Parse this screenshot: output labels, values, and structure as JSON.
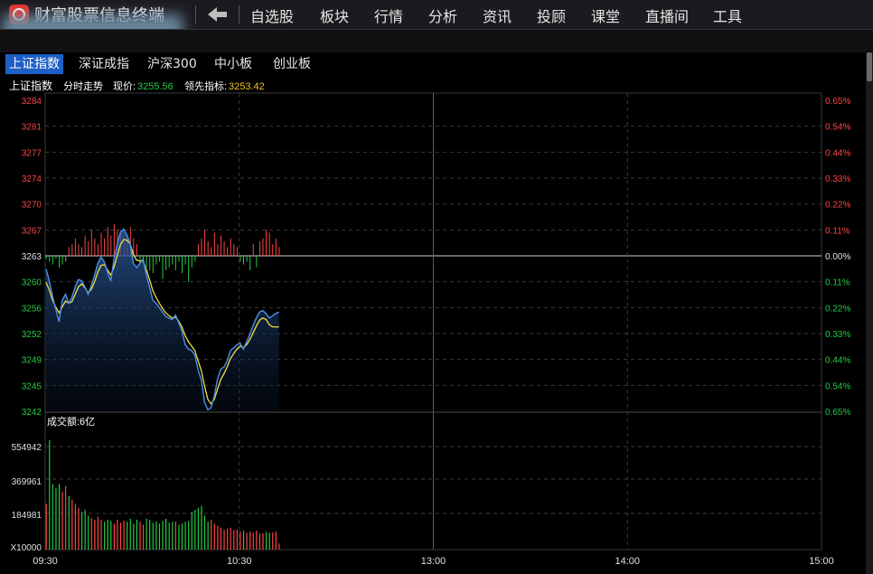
{
  "app": {
    "title": "财富股票信息终端"
  },
  "nav": {
    "items": [
      "自选股",
      "板块",
      "行情",
      "分析",
      "资讯",
      "投顾",
      "课堂",
      "直播间",
      "工具"
    ]
  },
  "tabs": [
    {
      "label": "上证指数",
      "active": true
    },
    {
      "label": "深证成指",
      "active": false
    },
    {
      "label": "沪深300",
      "active": false
    },
    {
      "label": "中小板",
      "active": false
    },
    {
      "label": "创业板",
      "active": false
    }
  ],
  "info": {
    "name": "上证指数",
    "mode": "分时走势",
    "price_label": "现价:",
    "price": "3255.56",
    "lead_label": "领先指标:",
    "lead": "3253.42"
  },
  "volume": {
    "label": "成交额:6亿"
  },
  "colors": {
    "up": "#ff4444",
    "down": "#22cc44",
    "price_line": "#4d8fe8",
    "lead_line": "#f0e040",
    "base": "#e0e0e0",
    "grid": "#3a3a3a",
    "background": "#000000"
  },
  "chart_data": {
    "type": "line",
    "ylim": [
      3242,
      3284
    ],
    "base": 3263,
    "y_left_ticks": [
      "3284",
      "3281",
      "3277",
      "3274",
      "3270",
      "3267",
      "3263",
      "3260",
      "3256",
      "3252",
      "3249",
      "3245",
      "3242"
    ],
    "y_right_ticks": [
      "0.65%",
      "0.54%",
      "0.44%",
      "0.33%",
      "0.22%",
      "0.11%",
      "0.00%",
      "0.11%",
      "0.22%",
      "0.33%",
      "0.44%",
      "0.54%",
      "0.65%"
    ],
    "x_ticks": [
      "09:30",
      "10:30",
      "13:00",
      "14:00",
      "15:00"
    ],
    "total_minutes": 240,
    "series": [
      {
        "values": [
          3261.2,
          3259.6,
          3257.5,
          3255.8,
          3254.1,
          3257.0,
          3257.8,
          3256.6,
          3257.4,
          3258.8,
          3259.8,
          3259.6,
          3258.8,
          3257.8,
          3259.0,
          3260.4,
          3262.0,
          3262.8,
          3262.2,
          3260.8,
          3259.6,
          3262.6,
          3264.6,
          3266.2,
          3266.6,
          3265.8,
          3264.6,
          3262.0,
          3261.4,
          3262.0,
          3262.6,
          3260.4,
          3258.8,
          3257.0,
          3256.6,
          3256.0,
          3255.4,
          3254.8,
          3254.6,
          3254.4,
          3255.0,
          3254.0,
          3252.8,
          3251.0,
          3250.4,
          3250.2,
          3249.6,
          3247.6,
          3246.2,
          3243.2,
          3242.2,
          3242.5,
          3244.0,
          3246.4,
          3247.7,
          3248.0,
          3248.8,
          3250.2,
          3250.6,
          3251.0,
          3251.2,
          3250.4,
          3251.4,
          3252.4,
          3253.6,
          3254.6,
          3255.4,
          3255.6,
          3255.2,
          3254.6,
          3254.9,
          3255.2,
          3255.4
        ]
      },
      {
        "values": [
          3259.4,
          3258.4,
          3257.0,
          3256.1,
          3255.3,
          3256.1,
          3256.9,
          3256.6,
          3256.8,
          3257.8,
          3258.8,
          3259.2,
          3258.7,
          3258.0,
          3258.5,
          3259.5,
          3260.8,
          3261.7,
          3261.8,
          3261.1,
          3260.4,
          3261.5,
          3263.0,
          3264.5,
          3265.2,
          3265.1,
          3264.6,
          3263.2,
          3262.4,
          3262.3,
          3262.3,
          3261.1,
          3259.8,
          3258.3,
          3257.4,
          3256.6,
          3255.9,
          3255.3,
          3254.9,
          3254.6,
          3254.7,
          3254.2,
          3253.4,
          3252.2,
          3251.4,
          3250.8,
          3250.2,
          3248.8,
          3247.5,
          3245.4,
          3243.6,
          3243.0,
          3243.6,
          3245.0,
          3246.3,
          3247.1,
          3248.0,
          3249.1,
          3249.8,
          3250.4,
          3250.8,
          3250.6,
          3251.0,
          3251.7,
          3252.6,
          3253.5,
          3254.3,
          3254.6,
          3254.4,
          3253.7,
          3253.4,
          3253.4,
          3253.4
        ]
      }
    ],
    "lead_diff": [
      -1,
      -2,
      -3,
      -1,
      -4,
      -3,
      -2,
      3,
      4,
      6,
      4,
      3,
      7,
      5,
      9,
      6,
      4,
      8,
      6,
      10,
      7,
      11,
      9,
      8,
      5,
      7,
      10,
      6,
      4,
      -3,
      -2,
      -4,
      -5,
      -6,
      -3,
      -2,
      -8,
      -5,
      -4,
      -3,
      -5,
      -2,
      -6,
      -3,
      -9,
      -4,
      -2,
      4,
      6,
      9,
      5,
      3,
      8,
      4,
      7,
      5,
      3,
      6,
      4,
      3,
      -2,
      -3,
      -2,
      -5,
      4,
      -4,
      5,
      6,
      9,
      8,
      4,
      6,
      3
    ],
    "volume": {
      "ylim": [
        10000,
        600000
      ],
      "y_ticks": [
        "554942",
        "369961",
        "184981",
        "X10000"
      ],
      "values": [
        240000,
        560000,
        340000,
        320000,
        340000,
        300000,
        330000,
        280000,
        260000,
        240000,
        220000,
        200000,
        210000,
        180000,
        170000,
        160000,
        175000,
        160000,
        150000,
        160000,
        155000,
        140000,
        160000,
        145000,
        155000,
        150000,
        165000,
        140000,
        160000,
        150000,
        135000,
        165000,
        160000,
        145000,
        150000,
        140000,
        155000,
        165000,
        145000,
        150000,
        150000,
        135000,
        140000,
        150000,
        155000,
        200000,
        210000,
        220000,
        230000,
        180000,
        150000,
        160000,
        140000,
        130000,
        120000,
        110000,
        115000,
        120000,
        108000,
        110000,
        100000,
        105000,
        95000,
        100000,
        95000,
        105000,
        90000,
        92000,
        98000,
        95000,
        96000,
        100000,
        40000
      ]
    }
  }
}
